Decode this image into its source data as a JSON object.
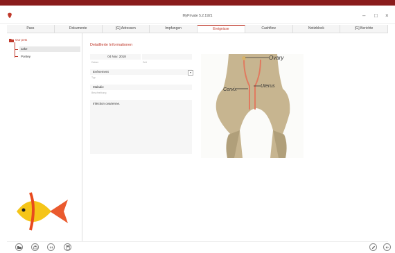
{
  "window": {
    "title": "MyPrivate 5.2.1921",
    "controls": {
      "minimize": "–",
      "maximize": "□",
      "close": "×"
    }
  },
  "tabs": [
    {
      "label": "Pass"
    },
    {
      "label": "Dokumente"
    },
    {
      "label": "[G] Adressen"
    },
    {
      "label": "Impfungen"
    },
    {
      "label": "Ereignisse",
      "active": true
    },
    {
      "label": "Cashflow"
    },
    {
      "label": "Notizblock"
    },
    {
      "label": "[G] Berichte"
    }
  ],
  "sidebar": {
    "root": "Our pets",
    "items": [
      {
        "label": "Jake"
      },
      {
        "label": "Pontey"
      }
    ]
  },
  "details": {
    "section_title": "Detaillierte Informationen",
    "date_value": "04 Nov. 2018",
    "date_caption": "Datum",
    "time_caption": "Zeit",
    "type_value": "Evènement",
    "type_caption": "Typ",
    "name_value": "Maladie",
    "name_caption": "Beschreibung",
    "notes_value": "Infection ovarienne."
  },
  "illustration": {
    "labels": {
      "ovary": "Ovary",
      "uterus": "Uterus",
      "cervix": "Cervix"
    }
  },
  "colors": {
    "accent": "#c0392b",
    "topbar": "#8a1c1c"
  }
}
